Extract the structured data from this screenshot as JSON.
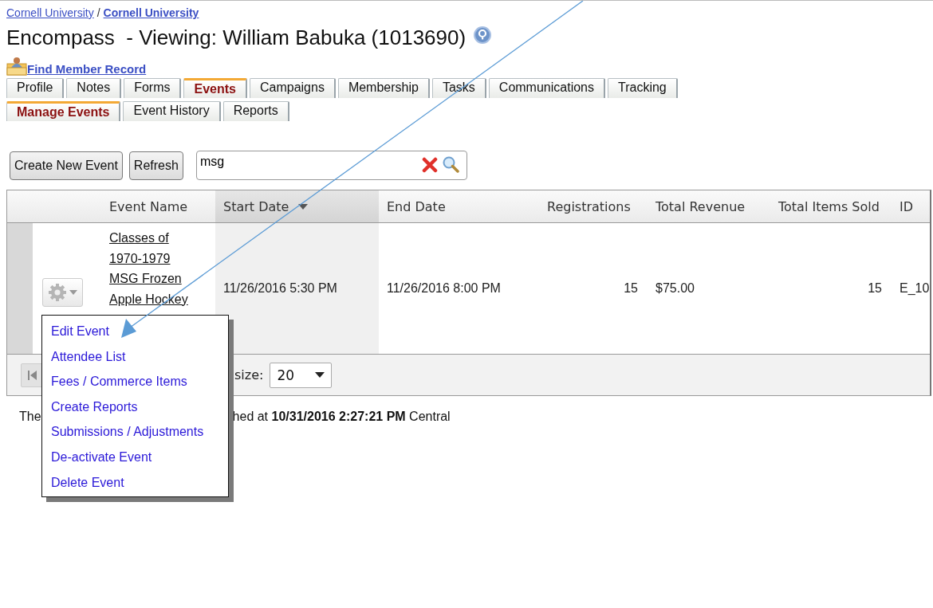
{
  "breadcrumb": [
    "Cornell University",
    "Cornell University"
  ],
  "breadcrumb_separator": "/",
  "title": "Encompass  - Viewing: William Babuka (1013690)",
  "find_member_link": "Find Member Record",
  "tabs": [
    {
      "label": "Profile",
      "selected": false
    },
    {
      "label": "Notes",
      "selected": false
    },
    {
      "label": "Forms",
      "selected": false
    },
    {
      "label": "Events",
      "selected": true
    },
    {
      "label": "Campaigns",
      "selected": false
    },
    {
      "label": "Membership",
      "selected": false
    },
    {
      "label": "Tasks",
      "selected": false
    },
    {
      "label": "Communications",
      "selected": false
    },
    {
      "label": "Tracking",
      "selected": false
    }
  ],
  "subtabs": [
    {
      "label": "Manage Events",
      "selected": true
    },
    {
      "label": "Event History",
      "selected": false
    },
    {
      "label": "Reports",
      "selected": false
    }
  ],
  "toolbar": {
    "buttons": [
      "Create New Event",
      "Refresh"
    ],
    "search": {
      "value": "msg"
    }
  },
  "grid": {
    "columns": [
      {
        "label": "Event Name",
        "sorted": false
      },
      {
        "label": "Start Date",
        "sorted": true
      },
      {
        "label": "End Date",
        "sorted": false
      },
      {
        "label": "Registrations",
        "sorted": false
      },
      {
        "label": "Total Revenue",
        "sorted": false
      },
      {
        "label": "Total Items Sold",
        "sorted": false
      },
      {
        "label": "ID",
        "sorted": false
      }
    ],
    "rows": [
      {
        "event_name": "Classes of 1970-1979 MSG Frozen Apple Hockey",
        "start_date": "11/26/2016 5:30 PM",
        "end_date": "11/26/2016 8:00 PM",
        "registrations": "15",
        "total_revenue": "$75.00",
        "total_items_sold": "15",
        "id": "E_10"
      }
    ],
    "pager": {
      "size_label": "size:",
      "page_size": "20"
    }
  },
  "footer_note": {
    "start": "The",
    "end": "hed at **10/31/2016 2:27:21 PM** Central"
  },
  "action_menu": [
    "Edit Event",
    "Attendee List",
    "Fees / Commerce Items",
    "Create Reports",
    "Submissions / Adjustments",
    "De-activate Event",
    "Delete Event"
  ]
}
